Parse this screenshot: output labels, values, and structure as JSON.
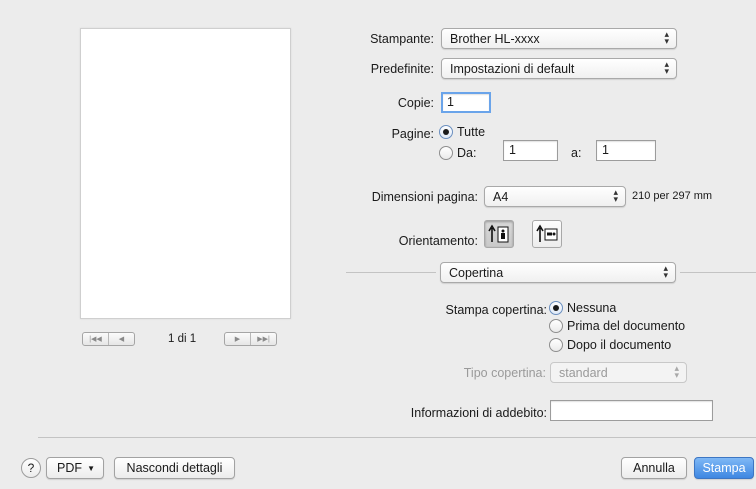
{
  "printer": {
    "label": "Stampante:",
    "value": "Brother HL-xxxx"
  },
  "presets": {
    "label": "Predefinite:",
    "value": "Impostazioni di default"
  },
  "copies": {
    "label": "Copie:",
    "value": "1"
  },
  "pages": {
    "label": "Pagine:",
    "all_label": "Tutte",
    "from_label": "Da:",
    "from_value": "1",
    "to_label": "a:",
    "to_value": "1"
  },
  "paper_size": {
    "label": "Dimensioni pagina:",
    "value": "A4",
    "dimensions": "210 per 297 mm"
  },
  "orientation": {
    "label": "Orientamento:",
    "selected": "portrait"
  },
  "section_menu": {
    "value": "Copertina"
  },
  "cover": {
    "label": "Stampa copertina:",
    "options": [
      "Nessuna",
      "Prima del documento",
      "Dopo il documento"
    ],
    "selected": "Nessuna",
    "type_label": "Tipo copertina:",
    "type_value": "standard"
  },
  "billing": {
    "label": "Informazioni di addebito:",
    "value": ""
  },
  "pager": {
    "text": "1 di 1"
  },
  "footer": {
    "help": "?",
    "pdf": "PDF",
    "hide_details": "Nascondi dettagli",
    "cancel": "Annulla",
    "print": "Stampa"
  }
}
